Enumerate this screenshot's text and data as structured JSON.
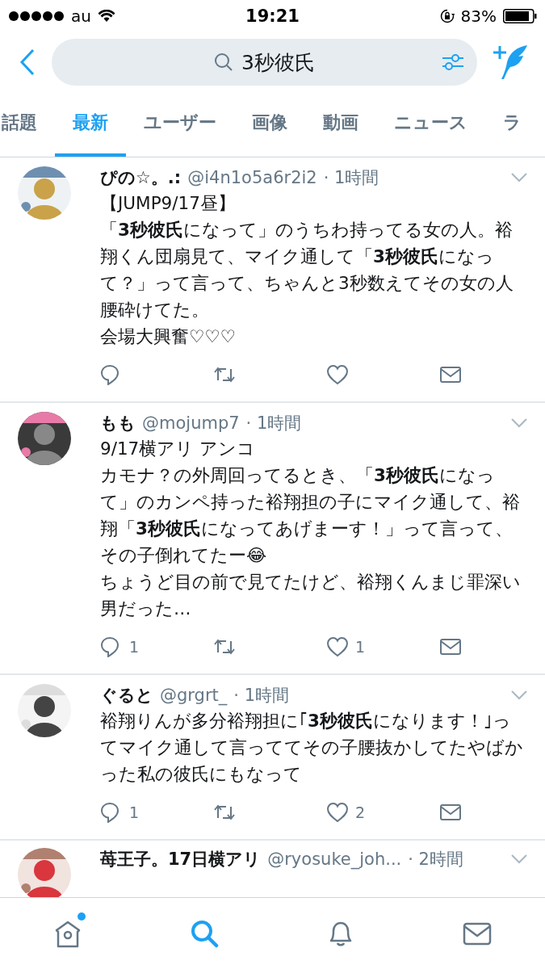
{
  "status_bar": {
    "carrier": "au",
    "time": "19:21",
    "battery": "83%"
  },
  "search": {
    "value": "3秒彼氏"
  },
  "tabs": [
    {
      "label": "話題",
      "selected": false
    },
    {
      "label": "最新",
      "selected": true
    },
    {
      "label": "ユーザー",
      "selected": false
    },
    {
      "label": "画像",
      "selected": false
    },
    {
      "label": "動画",
      "selected": false
    },
    {
      "label": "ニュース",
      "selected": false
    },
    {
      "label": "ラ",
      "selected": false
    }
  ],
  "tweets": [
    {
      "name": "ぴの☆。.:",
      "handle": "@i4n1o5a6r2i2",
      "time": "· 1時間",
      "lines": [
        "【JUMP9/17昼】",
        "「**3秒彼氏**になって」のうちわ持ってる女の人。裕翔くん団扇見て、マイク通して「**3秒彼氏**になって？」って言って、ちゃんと3秒数えてその女の人腰砕けてた。",
        "会場大興奮♡♡♡"
      ],
      "avatar": {
        "kind": "picture"
      }
    },
    {
      "name": "もも",
      "handle": "@mojump7",
      "time": "· 1時間",
      "lines": [
        "9/17横アリ アンコ",
        "カモナ？の外周回ってるとき、「**3秒彼氏**になって」のカンペ持った裕翔担の子にマイク通して、裕翔「**3秒彼氏**になってあげまーす！」って言って、その子倒れてたー😂",
        "ちょうど目の前で見てたけど、裕翔くんまじ罪深い男だった…"
      ],
      "replies": "1",
      "likes": "1",
      "avatar": {
        "kind": "picture"
      }
    },
    {
      "name": "ぐると",
      "handle": "@grgrt_",
      "time": "· 1時間",
      "lines": [
        "裕翔りんが多分裕翔担に｢**3秒彼氏**になります！｣ってマイク通して言っててその子腰抜かしてたやばかった私の彼氏にもなって"
      ],
      "replies": "1",
      "likes": "2",
      "avatar": {
        "kind": "picture"
      }
    },
    {
      "name": "苺王子。17日横アリ",
      "handle": "@ryosuke_joh...",
      "time": "· 2時間",
      "avatar": {
        "kind": "picture"
      }
    }
  ],
  "tab_bar": [
    {
      "kind": "home",
      "selected": false,
      "badge": true
    },
    {
      "kind": "search",
      "selected": true
    },
    {
      "kind": "notifications",
      "selected": false
    },
    {
      "kind": "messages",
      "selected": false
    }
  ]
}
